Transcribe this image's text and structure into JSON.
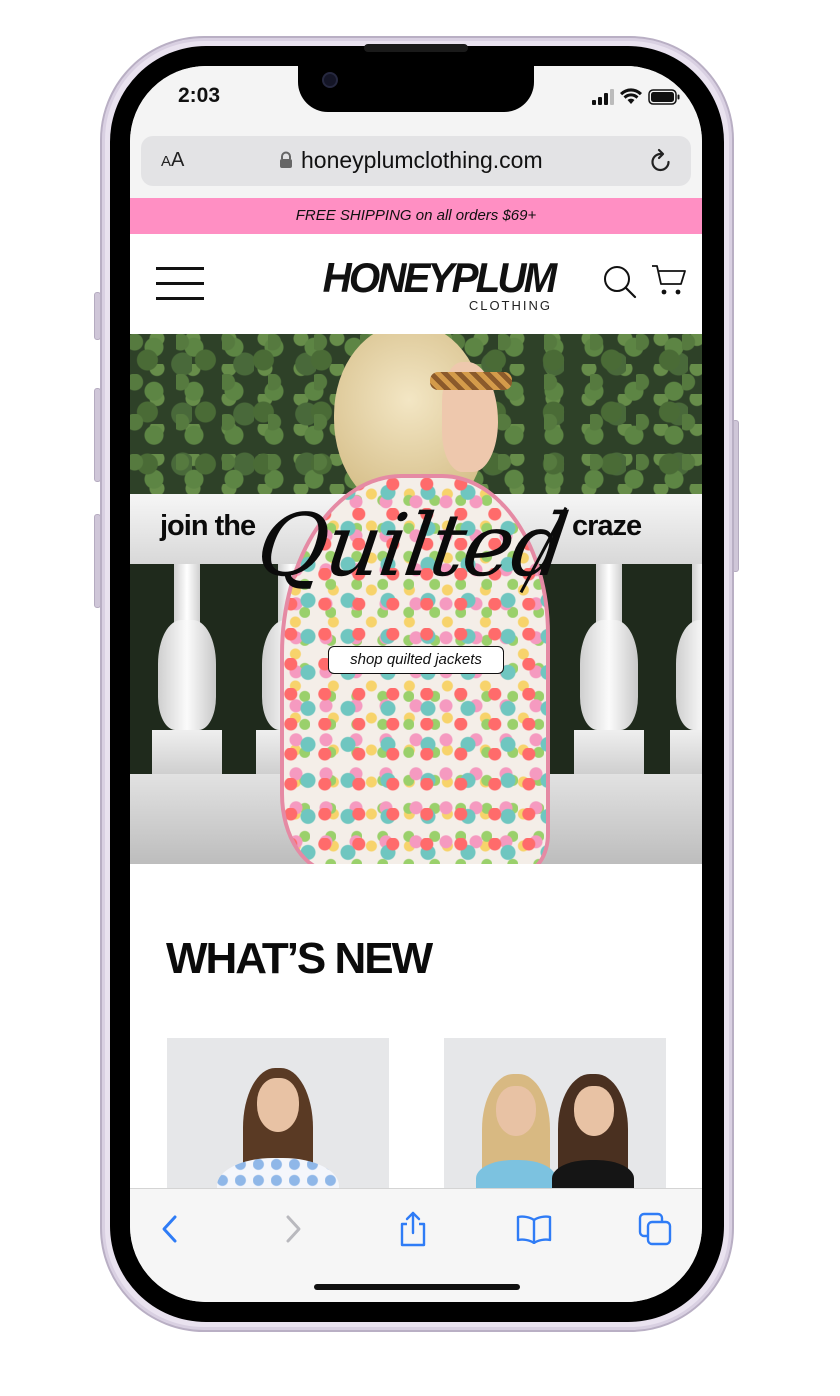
{
  "status_bar": {
    "time": "2:03"
  },
  "browser": {
    "text_size_label": "AA",
    "url": "honeyplumclothing.com"
  },
  "promo_banner": {
    "text": "FREE SHIPPING on all orders $69+"
  },
  "header": {
    "logo_main": "HONEYPLUM",
    "logo_sub": "CLOTHING"
  },
  "hero": {
    "tagline_start": "join the",
    "tagline_script": "Quilted",
    "tagline_end": "craze",
    "cta_label": "shop quilted jackets"
  },
  "sections": {
    "whats_new_title": "WHAT’S NEW"
  },
  "colors": {
    "promo_bg": "#ff8fc3",
    "safari_accent": "#2f7cf6"
  },
  "icons": {
    "menu": "hamburger-icon",
    "search": "search-icon",
    "cart": "cart-icon",
    "lock": "lock-icon",
    "reload": "reload-icon",
    "back": "back-icon",
    "forward": "forward-icon",
    "share": "share-icon",
    "bookmarks": "book-icon",
    "tabs": "tabs-icon"
  }
}
